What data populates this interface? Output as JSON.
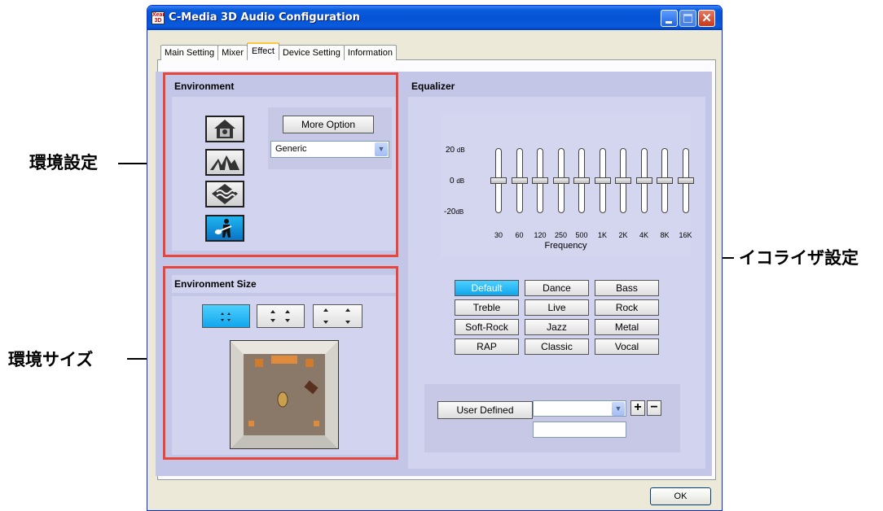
{
  "callouts": {
    "env_settings": "環境設定",
    "env_size": "環境サイズ",
    "eq_settings": "イコライザ設定"
  },
  "window": {
    "title": "C-Media 3D Audio Configuration",
    "icon_text": "Xear 3D",
    "controls": [
      "minimize-icon",
      "maximize-icon",
      "close-icon"
    ],
    "close_glyph": "✕"
  },
  "tabs": [
    {
      "label": "Main Setting"
    },
    {
      "label": "Mixer"
    },
    {
      "label": "Effect",
      "active": true
    },
    {
      "label": "Device Setting"
    },
    {
      "label": "Information"
    }
  ],
  "environment": {
    "title": "Environment",
    "more_option": "More Option",
    "preset": "Generic",
    "buttons": [
      "house-icon",
      "opera-house-icon",
      "water-icon",
      "guitarist-icon"
    ],
    "selected_button": 3
  },
  "environment_size": {
    "title": "Environment Size",
    "sizes": [
      "small-room-icon",
      "medium-room-icon",
      "large-room-icon"
    ],
    "selected": 0
  },
  "equalizer": {
    "title": "Equalizer",
    "db_labels": {
      "top": "20",
      "mid": "0",
      "bot": "-20",
      "unit": "dB"
    },
    "bands": [
      "30",
      "60",
      "120",
      "250",
      "500",
      "1K",
      "2K",
      "4K",
      "8K",
      "16K"
    ],
    "band_gains_db": [
      0,
      0,
      0,
      0,
      0,
      0,
      0,
      0,
      0,
      0
    ],
    "frequency_label": "Frequency",
    "presets": [
      "Default",
      "Dance",
      "Bass",
      "Treble",
      "Live",
      "Rock",
      "Soft-Rock",
      "Jazz",
      "Metal",
      "RAP",
      "Classic",
      "Vocal"
    ],
    "selected_preset": "Default",
    "user_defined": "User Defined",
    "user_select_value": "",
    "user_name_value": "",
    "plus": "+",
    "minus": "−"
  },
  "footer": {
    "ok": "OK"
  },
  "colors": {
    "highlight_box": "#e8463a",
    "panel": "#c4c6e7",
    "selected": "#1fb6f0"
  }
}
